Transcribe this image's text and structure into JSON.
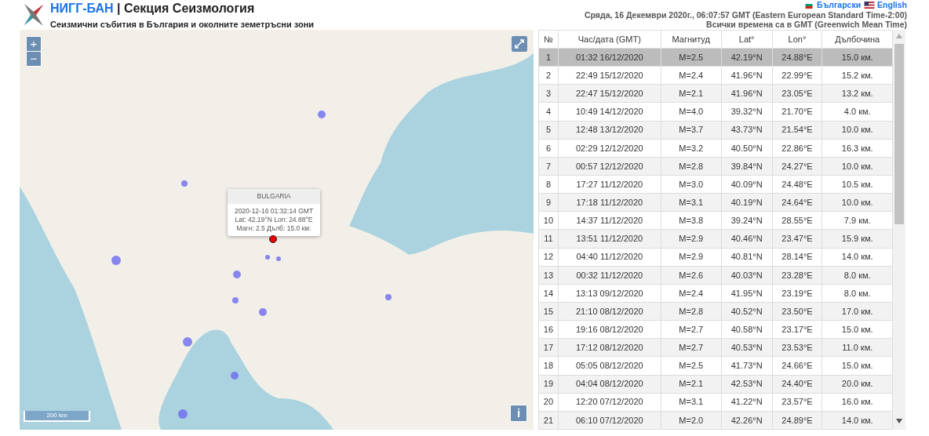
{
  "header": {
    "org": "НИГГ-БАН",
    "section": "| Секция Сеизмология",
    "subtitle": "Сеизмични събития в България и околните земетръсни зони"
  },
  "languages": [
    "Български",
    "English"
  ],
  "datetime": "Сряда, 16 Декември 2020г., 06:07:57 GMT (Eastern European Standard Time-2:00)",
  "timezone_note": "Всички времена са в GMT (Greenwich Mean Time)",
  "map": {
    "zoom_in": "+",
    "zoom_out": "−",
    "scale": "200 km",
    "info": "i",
    "popup": {
      "title": "BULGARIA",
      "lines": [
        "2020-12-16 01:32:14 GMT",
        "Lat: 42.19°N Lon: 24.88°E",
        "Магн: 2.5 Дълб: 15.0 км."
      ]
    }
  },
  "table": {
    "columns": [
      "№",
      "Час/дата (GMT)",
      "Магнитуд",
      "Lat°",
      "Lon°",
      "Дълбочина"
    ],
    "rows": [
      {
        "cells": [
          "1",
          "01:32 16/12/2020",
          "M=2.5",
          "42.19°N",
          "24.88°E",
          "15.0 км."
        ],
        "selected": true
      },
      {
        "cells": [
          "2",
          "22:49 15/12/2020",
          "M=2.4",
          "41.96°N",
          "22.99°E",
          "15.2 км."
        ],
        "selected": false
      },
      {
        "cells": [
          "3",
          "22:47 15/12/2020",
          "M=2.1",
          "41.96°N",
          "23.05°E",
          "13.2 км."
        ],
        "selected": false
      },
      {
        "cells": [
          "4",
          "10:49 14/12/2020",
          "M=4.0",
          "39.32°N",
          "21.70°E",
          "4.0 км."
        ],
        "selected": false
      },
      {
        "cells": [
          "5",
          "12:48 13/12/2020",
          "M=3.7",
          "43.73°N",
          "21.54°E",
          "10.0 км."
        ],
        "selected": false
      },
      {
        "cells": [
          "6",
          "02:29 12/12/2020",
          "M=3.2",
          "40.50°N",
          "22.86°E",
          "16.3 км."
        ],
        "selected": false
      },
      {
        "cells": [
          "7",
          "00:57 12/12/2020",
          "M=2.8",
          "39.84°N",
          "24.27°E",
          "10.0 км."
        ],
        "selected": false
      },
      {
        "cells": [
          "8",
          "17:27 11/12/2020",
          "M=3.0",
          "40.09°N",
          "24.48°E",
          "10.5 км."
        ],
        "selected": false
      },
      {
        "cells": [
          "9",
          "17:18 11/12/2020",
          "M=3.1",
          "40.19°N",
          "24.64°E",
          "10.0 км."
        ],
        "selected": false
      },
      {
        "cells": [
          "10",
          "14:37 11/12/2020",
          "M=3.8",
          "39.24°N",
          "28.55°E",
          "7.9 км."
        ],
        "selected": false
      },
      {
        "cells": [
          "11",
          "13:51 11/12/2020",
          "M=2.9",
          "40.46°N",
          "23.47°E",
          "15.9 км."
        ],
        "selected": false
      },
      {
        "cells": [
          "12",
          "04:40 11/12/2020",
          "M=2.9",
          "40.81°N",
          "28.14°E",
          "14.0 км."
        ],
        "selected": false
      },
      {
        "cells": [
          "13",
          "00:32 11/12/2020",
          "M=2.6",
          "40.03°N",
          "23.28°E",
          "8.0 км."
        ],
        "selected": false
      },
      {
        "cells": [
          "14",
          "13:13 09/12/2020",
          "M=2.4",
          "41.95°N",
          "23.19°E",
          "8.0 км."
        ],
        "selected": false
      },
      {
        "cells": [
          "15",
          "21:10 08/12/2020",
          "M=2.8",
          "40.52°N",
          "23.50°E",
          "17.0 км."
        ],
        "selected": false
      },
      {
        "cells": [
          "16",
          "19:16 08/12/2020",
          "M=2.7",
          "40.58°N",
          "23.17°E",
          "15.0 км."
        ],
        "selected": false
      },
      {
        "cells": [
          "17",
          "17:12 08/12/2020",
          "M=2.7",
          "40.53°N",
          "23.53°E",
          "11.0 км."
        ],
        "selected": false
      },
      {
        "cells": [
          "18",
          "05:05 08/12/2020",
          "M=2.5",
          "41.73°N",
          "24.66°E",
          "15.0 км."
        ],
        "selected": false
      },
      {
        "cells": [
          "19",
          "04:04 08/12/2020",
          "M=2.1",
          "42.53°N",
          "24.40°E",
          "20.0 км."
        ],
        "selected": false
      },
      {
        "cells": [
          "20",
          "12:20 07/12/2020",
          "M=3.1",
          "41.22°N",
          "23.57°E",
          "16.0 км."
        ],
        "selected": false
      },
      {
        "cells": [
          "21",
          "06:10 07/12/2020",
          "M=2.0",
          "42.26°N",
          "24.89°E",
          "14.0 км."
        ],
        "selected": false
      }
    ]
  }
}
